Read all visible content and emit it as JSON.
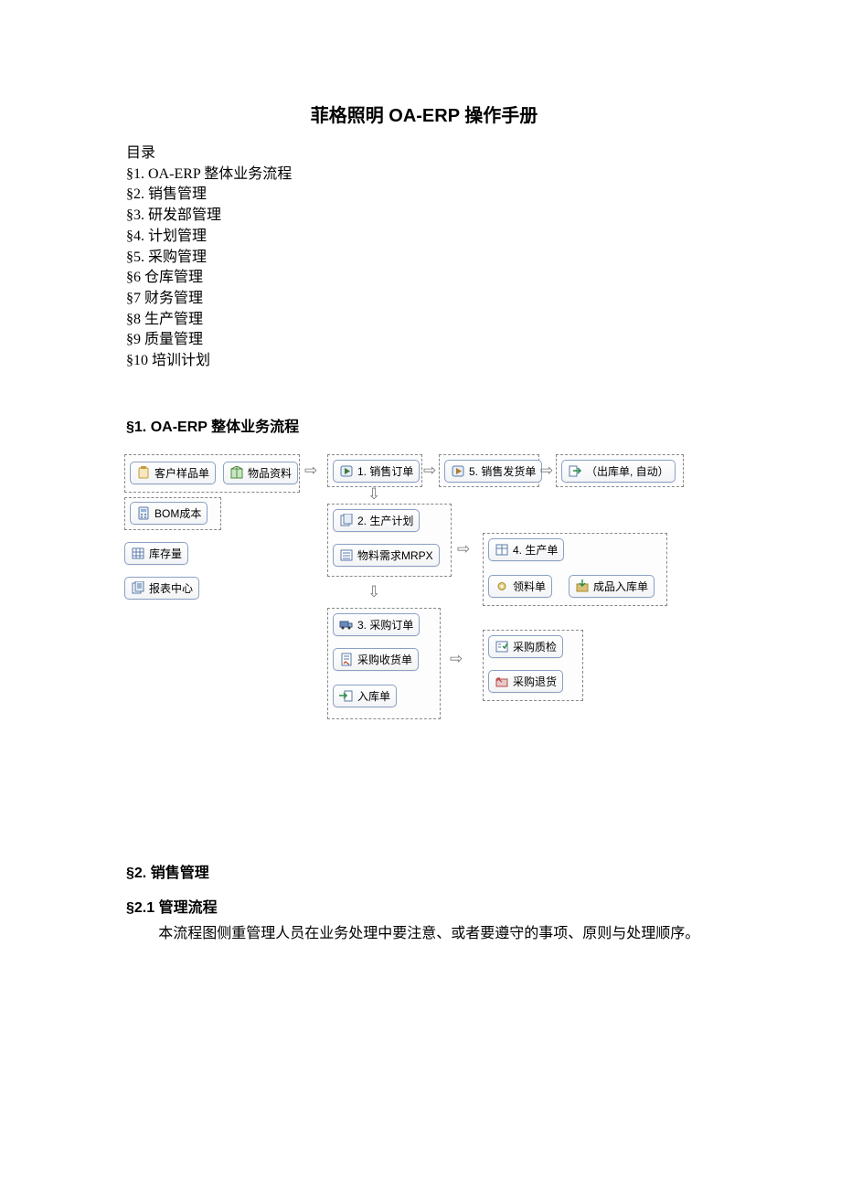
{
  "title": "菲格照明 OA-ERP 操作手册",
  "toc_heading": "目录",
  "toc": [
    "§1. OA-ERP 整体业务流程",
    "§2. 销售管理",
    "§3. 研发部管理",
    "§4. 计划管理",
    "§5. 采购管理",
    "§6  仓库管理",
    "§7  财务管理",
    "§8  生产管理",
    "§9  质量管理",
    "§10 培训计划"
  ],
  "section1_heading": "§1. OA-ERP 整体业务流程",
  "nodes": {
    "customer_sample": "客户样品单",
    "item_master": "物品资料",
    "bom_cost": "BOM成本",
    "stock_qty": "库存量",
    "report_center": "报表中心",
    "sales_order": "1. 销售订单",
    "delivery_note": "5. 销售发货单",
    "outbound_auto": "（出库单, 自动）",
    "prod_plan": "2. 生产计划",
    "mrp": "物料需求MRPX",
    "po": "3. 采购订单",
    "po_receipt": "采购收货单",
    "inbound": "入库单",
    "prod_order": "4. 生产单",
    "material_req": "领料单",
    "fg_inbound": "成品入库单",
    "po_qc": "采购质检",
    "po_return": "采购退货"
  },
  "section2_heading": "§2. 销售管理",
  "section2_1_heading": "§2.1  管理流程",
  "section2_1_body": "本流程图侧重管理人员在业务处理中要注意、或者要遵守的事项、原则与处理顺序。"
}
